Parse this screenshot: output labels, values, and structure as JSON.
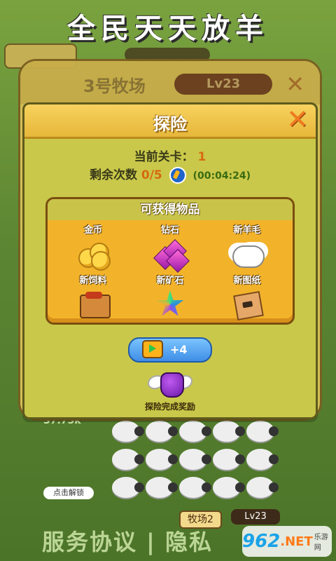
{
  "banner_title": "全民天天放羊",
  "background": {
    "ranch_title": "3号牧场",
    "ranch_level": "Lv23",
    "stats_text": "37.75k",
    "tap_unlock": "点击解锁",
    "footer_links": "服务协议 | 隐私",
    "farm_tag": "牧场2",
    "farm_level": "Lv23"
  },
  "dialog": {
    "title": "探险",
    "current_level_label": "当前关卡：",
    "current_level_value": "1",
    "remaining_label": "剩余次数",
    "remaining_value": "0/5",
    "timer": "(00:04:24)",
    "items_title": "可获得物品",
    "items": [
      {
        "label": "金币",
        "icon": "gold-coin-icon"
      },
      {
        "label": "钻石",
        "icon": "diamond-icon"
      },
      {
        "label": "新羊毛",
        "icon": "wool-icon"
      },
      {
        "label": "新饲料",
        "icon": "feed-crate-icon"
      },
      {
        "label": "新矿石",
        "icon": "ore-star-icon"
      },
      {
        "label": "新图纸",
        "icon": "blueprint-icon"
      }
    ],
    "video_button_label": "+4",
    "reward_label": "探险完成奖励"
  },
  "watermark": {
    "number": "962",
    "suffix": ".NET",
    "site": "乐游网"
  },
  "colors": {
    "accent": "#f07a1e",
    "panel": "#f2b32a",
    "dialog_bg": "#c9c84a",
    "button": "#3f8ee6"
  }
}
